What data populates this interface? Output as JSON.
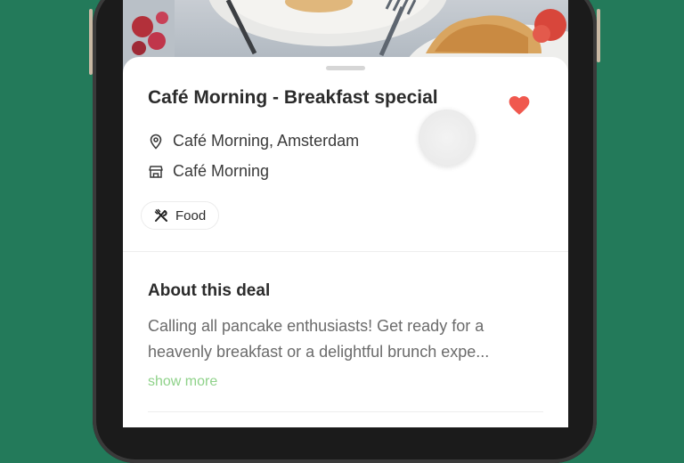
{
  "deal": {
    "title": "Café Morning - Breakfast special",
    "location": "Café Morning, Amsterdam",
    "venue": "Café Morning",
    "category": "Food",
    "favorited": true
  },
  "about": {
    "heading": "About this deal",
    "line1": "Calling all pancake enthusiasts! Get ready for a",
    "line2": "heavenly breakfast or a delightful brunch expe...",
    "show_more": "show more"
  },
  "colors": {
    "background": "#237a5a",
    "heart": "#f0584e",
    "show_more": "#8fd28a",
    "title": "#2b2b2b",
    "body_text": "#6b6b6b"
  },
  "icons": {
    "location": "map-pin-icon",
    "venue": "store-icon",
    "category": "fork-knife-icon",
    "favorite": "heart-icon"
  }
}
